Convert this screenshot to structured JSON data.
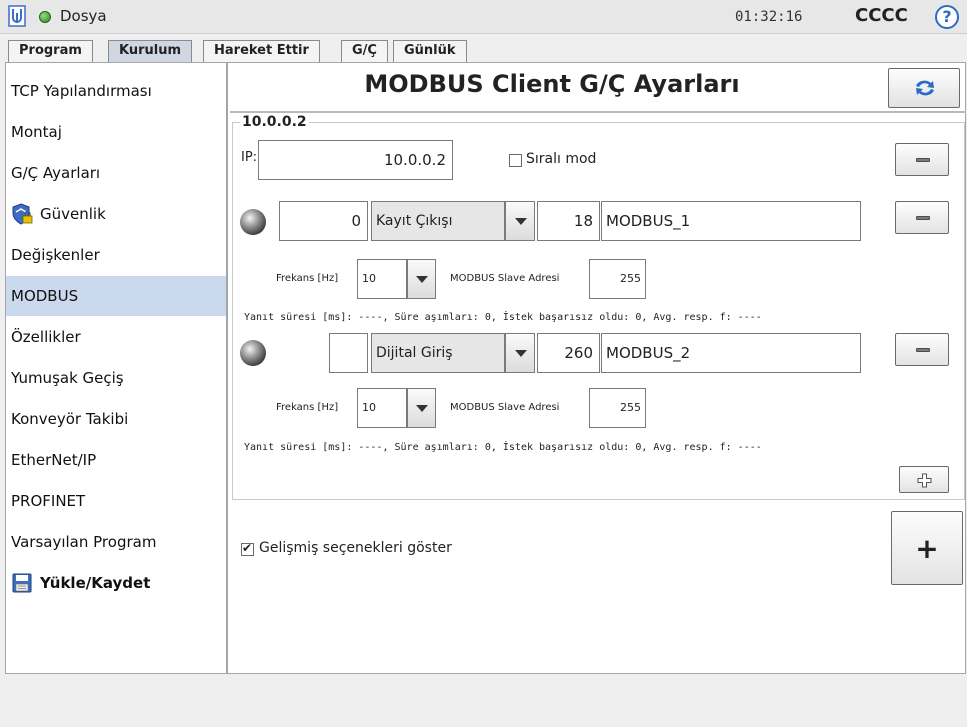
{
  "topbar": {
    "file_label": "Dosya",
    "clock": "01:32:16",
    "user": "CCCC",
    "help_icon": "?"
  },
  "tabs": [
    {
      "label": "Program",
      "active": false
    },
    {
      "label": "Kurulum",
      "active": true
    },
    {
      "label": "Hareket Ettir",
      "active": false
    },
    {
      "label": "G/Ç",
      "active": false
    },
    {
      "label": "Günlük",
      "active": false
    }
  ],
  "sidebar": {
    "items": [
      {
        "label": "TCP Yapılandırması"
      },
      {
        "label": "Montaj"
      },
      {
        "label": "G/Ç Ayarları"
      },
      {
        "label": "Güvenlik",
        "icon": "shield-lock-icon"
      },
      {
        "label": "Değişkenler"
      },
      {
        "label": "MODBUS",
        "active": true
      },
      {
        "label": "Özellikler"
      },
      {
        "label": "Yumuşak Geçiş"
      },
      {
        "label": "Konveyör Takibi"
      },
      {
        "label": "EtherNet/IP"
      },
      {
        "label": "PROFINET"
      },
      {
        "label": "Varsayılan Program"
      },
      {
        "label": "Yükle/Kaydet",
        "icon": "floppy-disk-icon"
      }
    ]
  },
  "main": {
    "title": "MODBUS Client G/Ç Ayarları",
    "group_label": "10.0.0.2",
    "ip_label": "IP:",
    "ip_value": "10.0.0.2",
    "sequential_label": "Sıralı mod",
    "sequential_checked": false,
    "signals": [
      {
        "led": "off",
        "value": "0",
        "type": "Kayıt Çıkışı",
        "address": "18",
        "name": "MODBUS_1",
        "freq_label": "Frekans [Hz]",
        "freq_value": "10",
        "slave_label": "MODBUS Slave Adresi",
        "slave_value": "255",
        "stats": "Yanıt süresi [ms]: ----, Süre aşımları: 0, İstek başarısız oldu: 0, Avg. resp. f: ----"
      },
      {
        "led": "off",
        "value": "",
        "type": "Dijital Giriş",
        "address": "260",
        "name": "MODBUS_2",
        "freq_label": "Frekans [Hz]",
        "freq_value": "10",
        "slave_label": "MODBUS Slave Adresi",
        "slave_value": "255",
        "stats": "Yanıt süresi [ms]: ----, Süre aşımları: 0, İstek başarısız oldu: 0, Avg. resp. f: ----"
      }
    ],
    "advanced_label": "Gelişmiş seçenekleri göster",
    "advanced_checked": true,
    "add_button": "+"
  },
  "colors": {
    "accent_blue": "#2c6ac9",
    "sidebar_active": "#cbd9ef",
    "tab_active": "#cfd7e3",
    "status_green": "#3aa12a"
  }
}
